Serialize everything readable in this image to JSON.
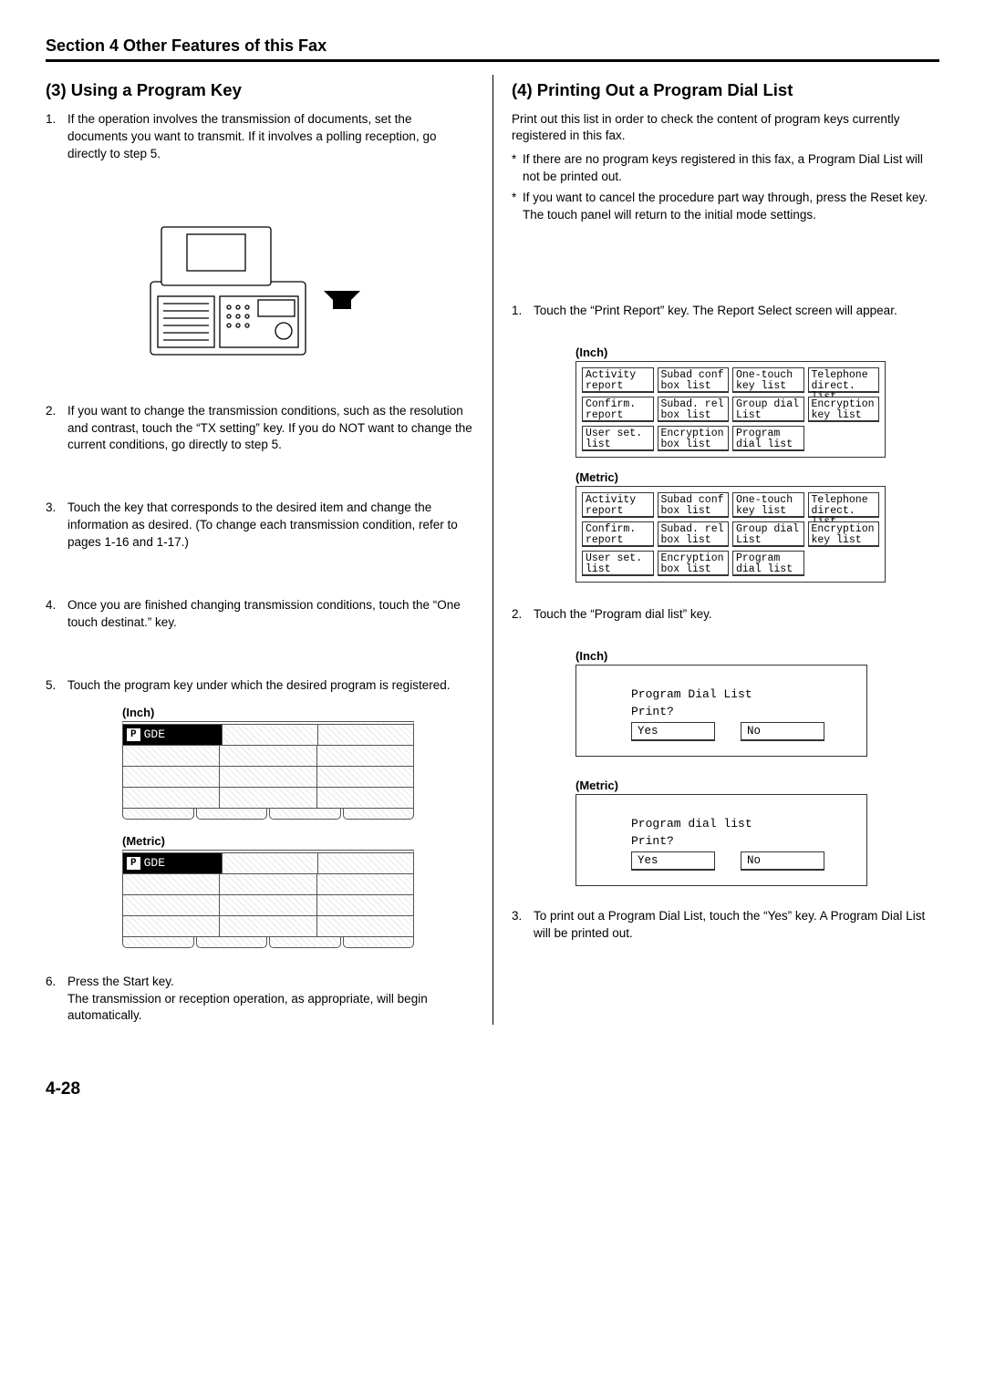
{
  "header": "Section 4 Other Features of this Fax",
  "page_number": "4-28",
  "left": {
    "heading": "(3) Using a Program Key",
    "steps": [
      "If the operation involves the transmission of documents, set the documents you want to transmit. If it involves a polling reception, go directly to step 5.",
      "If you want to change the transmission conditions, such as the resolution and contrast, touch the “TX setting” key. If you do NOT want to change the current conditions, go directly to step 5.",
      "Touch the key that corresponds to the desired item and change the information as desired. (To change each transmission condition, refer to pages 1-16 and 1-17.)",
      "Once you are finished changing transmission conditions, touch the “One touch destinat.” key.",
      "Touch the program key under which the desired program is registered.",
      "Press the Start key.\nThe transmission or reception operation, as appropriate, will begin automatically."
    ],
    "panel_inch_label": "(Inch)",
    "panel_metric_label": "(Metric)",
    "prog_key_label": "GDE"
  },
  "right": {
    "heading": "(4) Printing Out a Program Dial List",
    "intro": "Print out this list in order to check the content of program keys currently registered in this fax.",
    "notes": [
      "If there are no program keys registered in this fax, a Program Dial List will not be printed out.",
      "If you want to cancel the procedure part way through, press the Reset key. The touch panel will return to the initial mode settings."
    ],
    "steps": [
      "Touch the “Print Report” key. The Report Select screen will appear.",
      "Touch the “Program dial list” key.",
      "To print out a Program Dial List, touch the “Yes” key. A Program Dial List will be printed out."
    ],
    "panel_inch_label": "(Inch)",
    "panel_metric_label": "(Metric)",
    "report_buttons_inch": [
      "Activity\nreport",
      "Subad conf\nbox list",
      "One-touch\nkey list",
      "Telephone\ndirect. list",
      "Confirm.\nreport",
      "Subad. rel\nbox list",
      "Group dial\nList",
      "Encryption\nkey list",
      "User set.\nlist",
      "Encryption\nbox list",
      "Program\ndial list",
      ""
    ],
    "report_buttons_metric": [
      "Activity\nreport",
      "Subad conf\nbox list",
      "One-touch\nkey list",
      "Telephone\ndirect. list",
      "Confirm.\nreport",
      "Subad. rel\nbox list",
      "Group dial\nList",
      "Encryption\nkey list",
      "User set.\nlist",
      "Encryption\nbox list",
      "Program\ndial list",
      ""
    ],
    "dialog_inch": {
      "title": "Program Dial List",
      "sub": "Print?",
      "yes": "Yes",
      "no": "No"
    },
    "dialog_metric": {
      "title": "Program dial list",
      "sub": "Print?",
      "yes": "Yes",
      "no": "No"
    }
  }
}
